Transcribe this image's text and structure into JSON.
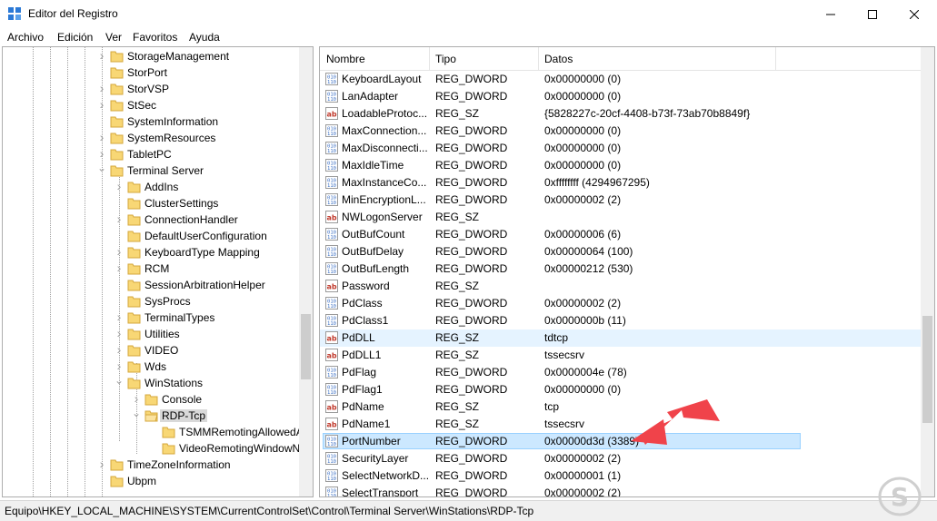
{
  "window": {
    "title": "Editor del Registro"
  },
  "menu": [
    "Archivo",
    "Edición",
    "Ver",
    "Favoritos",
    "Ayuda"
  ],
  "tree": [
    {
      "label": "StorageManagement",
      "level": 0,
      "expander": "collapsed"
    },
    {
      "label": "StorPort",
      "level": 0,
      "expander": "none"
    },
    {
      "label": "StorVSP",
      "level": 0,
      "expander": "collapsed"
    },
    {
      "label": "StSec",
      "level": 0,
      "expander": "collapsed"
    },
    {
      "label": "SystemInformation",
      "level": 0,
      "expander": "none"
    },
    {
      "label": "SystemResources",
      "level": 0,
      "expander": "collapsed"
    },
    {
      "label": "TabletPC",
      "level": 0,
      "expander": "collapsed"
    },
    {
      "label": "Terminal Server",
      "level": 0,
      "expander": "expanded"
    },
    {
      "label": "AddIns",
      "level": 1,
      "expander": "collapsed"
    },
    {
      "label": "ClusterSettings",
      "level": 1,
      "expander": "none"
    },
    {
      "label": "ConnectionHandler",
      "level": 1,
      "expander": "collapsed"
    },
    {
      "label": "DefaultUserConfiguration",
      "level": 1,
      "expander": "none"
    },
    {
      "label": "KeyboardType Mapping",
      "level": 1,
      "expander": "collapsed"
    },
    {
      "label": "RCM",
      "level": 1,
      "expander": "collapsed"
    },
    {
      "label": "SessionArbitrationHelper",
      "level": 1,
      "expander": "none"
    },
    {
      "label": "SysProcs",
      "level": 1,
      "expander": "none"
    },
    {
      "label": "TerminalTypes",
      "level": 1,
      "expander": "collapsed"
    },
    {
      "label": "Utilities",
      "level": 1,
      "expander": "collapsed"
    },
    {
      "label": "VIDEO",
      "level": 1,
      "expander": "collapsed"
    },
    {
      "label": "Wds",
      "level": 1,
      "expander": "collapsed"
    },
    {
      "label": "WinStations",
      "level": 1,
      "expander": "expanded"
    },
    {
      "label": "Console",
      "level": 2,
      "expander": "collapsed"
    },
    {
      "label": "RDP-Tcp",
      "level": 2,
      "expander": "expanded",
      "selected": true
    },
    {
      "label": "TSMMRemotingAllowedApps",
      "level": 3,
      "expander": "none"
    },
    {
      "label": "VideoRemotingWindowNames",
      "level": 3,
      "expander": "none"
    },
    {
      "label": "TimeZoneInformation",
      "level": 0,
      "expander": "collapsed"
    },
    {
      "label": "Ubpm",
      "level": 0,
      "expander": "none"
    }
  ],
  "columns": {
    "name": "Nombre",
    "type": "Tipo",
    "data": "Datos"
  },
  "values": [
    {
      "name": "KeyboardLayout",
      "type": "REG_DWORD",
      "data": "0x00000000 (0)",
      "icon": "dword"
    },
    {
      "name": "LanAdapter",
      "type": "REG_DWORD",
      "data": "0x00000000 (0)",
      "icon": "dword"
    },
    {
      "name": "LoadableProtoc...",
      "type": "REG_SZ",
      "data": "{5828227c-20cf-4408-b73f-73ab70b8849f}",
      "icon": "sz"
    },
    {
      "name": "MaxConnection...",
      "type": "REG_DWORD",
      "data": "0x00000000 (0)",
      "icon": "dword"
    },
    {
      "name": "MaxDisconnecti...",
      "type": "REG_DWORD",
      "data": "0x00000000 (0)",
      "icon": "dword"
    },
    {
      "name": "MaxIdleTime",
      "type": "REG_DWORD",
      "data": "0x00000000 (0)",
      "icon": "dword"
    },
    {
      "name": "MaxInstanceCo...",
      "type": "REG_DWORD",
      "data": "0xffffffff (4294967295)",
      "icon": "dword"
    },
    {
      "name": "MinEncryptionL...",
      "type": "REG_DWORD",
      "data": "0x00000002 (2)",
      "icon": "dword"
    },
    {
      "name": "NWLogonServer",
      "type": "REG_SZ",
      "data": "",
      "icon": "sz"
    },
    {
      "name": "OutBufCount",
      "type": "REG_DWORD",
      "data": "0x00000006 (6)",
      "icon": "dword"
    },
    {
      "name": "OutBufDelay",
      "type": "REG_DWORD",
      "data": "0x00000064 (100)",
      "icon": "dword"
    },
    {
      "name": "OutBufLength",
      "type": "REG_DWORD",
      "data": "0x00000212 (530)",
      "icon": "dword"
    },
    {
      "name": "Password",
      "type": "REG_SZ",
      "data": "",
      "icon": "sz"
    },
    {
      "name": "PdClass",
      "type": "REG_DWORD",
      "data": "0x00000002 (2)",
      "icon": "dword"
    },
    {
      "name": "PdClass1",
      "type": "REG_DWORD",
      "data": "0x0000000b (11)",
      "icon": "dword"
    },
    {
      "name": "PdDLL",
      "type": "REG_SZ",
      "data": "tdtcp",
      "icon": "sz",
      "hover": true
    },
    {
      "name": "PdDLL1",
      "type": "REG_SZ",
      "data": "tssecsrv",
      "icon": "sz"
    },
    {
      "name": "PdFlag",
      "type": "REG_DWORD",
      "data": "0x0000004e (78)",
      "icon": "dword"
    },
    {
      "name": "PdFlag1",
      "type": "REG_DWORD",
      "data": "0x00000000 (0)",
      "icon": "dword"
    },
    {
      "name": "PdName",
      "type": "REG_SZ",
      "data": "tcp",
      "icon": "sz"
    },
    {
      "name": "PdName1",
      "type": "REG_SZ",
      "data": "tssecsrv",
      "icon": "sz"
    },
    {
      "name": "PortNumber",
      "type": "REG_DWORD",
      "data": "0x00000d3d (3389)",
      "icon": "dword",
      "selected": true
    },
    {
      "name": "SecurityLayer",
      "type": "REG_DWORD",
      "data": "0x00000002 (2)",
      "icon": "dword"
    },
    {
      "name": "SelectNetworkD...",
      "type": "REG_DWORD",
      "data": "0x00000001 (1)",
      "icon": "dword"
    },
    {
      "name": "SelectTransport",
      "type": "REG_DWORD",
      "data": "0x00000002 (2)",
      "icon": "dword"
    }
  ],
  "status": {
    "path": "Equipo\\HKEY_LOCAL_MACHINE\\SYSTEM\\CurrentControlSet\\Control\\Terminal Server\\WinStations\\RDP-Tcp"
  },
  "icons": {
    "folder": "folder-icon",
    "dword": "reg-dword-icon",
    "sz": "reg-sz-icon",
    "app": "registry-editor-icon"
  },
  "colors": {
    "folder": "#f8d775",
    "selection": "#cce8ff",
    "selection_border": "#99d1ff",
    "hover": "#e5f3ff",
    "arrow": "#f0434a",
    "dword_icon": "#3a6fc4",
    "sz_icon": "#c0392b"
  }
}
